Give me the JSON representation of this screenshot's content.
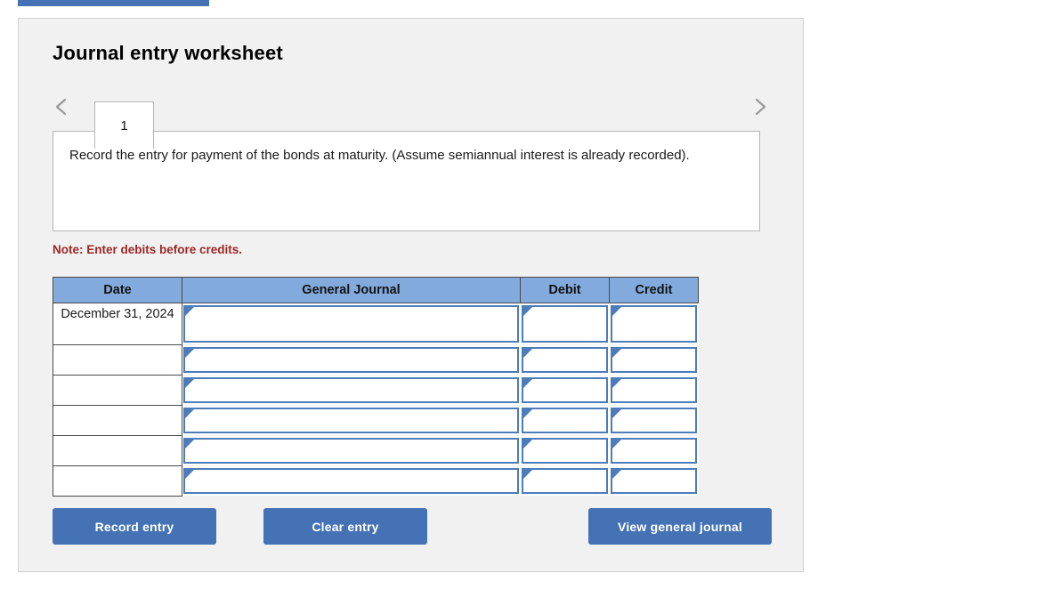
{
  "top_tab": {
    "label": ""
  },
  "panel": {
    "title": "Journal entry worksheet"
  },
  "nav": {
    "prev_icon": "chevron-left-icon",
    "next_icon": "chevron-right-icon",
    "tabs": [
      {
        "label": "1",
        "active": true
      }
    ]
  },
  "prompt": {
    "text": "Record the entry for payment of the bonds at maturity. (Assume semiannual interest is already recorded)."
  },
  "note": {
    "text": "Note: Enter debits before credits."
  },
  "table": {
    "headers": [
      "Date",
      "General Journal",
      "Debit",
      "Credit"
    ],
    "rows": [
      {
        "date": "December 31, 2024",
        "general_journal": "",
        "debit": "",
        "credit": ""
      },
      {
        "date": "",
        "general_journal": "",
        "debit": "",
        "credit": ""
      },
      {
        "date": "",
        "general_journal": "",
        "debit": "",
        "credit": ""
      },
      {
        "date": "",
        "general_journal": "",
        "debit": "",
        "credit": ""
      },
      {
        "date": "",
        "general_journal": "",
        "debit": "",
        "credit": ""
      },
      {
        "date": "",
        "general_journal": "",
        "debit": "",
        "credit": ""
      }
    ]
  },
  "buttons": {
    "record": "Record entry",
    "clear": "Clear entry",
    "view": "View general journal"
  },
  "colors": {
    "header_blue": "#82aadd",
    "button_blue": "#4472b4",
    "cell_border_blue": "#4d7cbb",
    "note_red": "#9c2626",
    "panel_bg": "#f1f1f1"
  }
}
